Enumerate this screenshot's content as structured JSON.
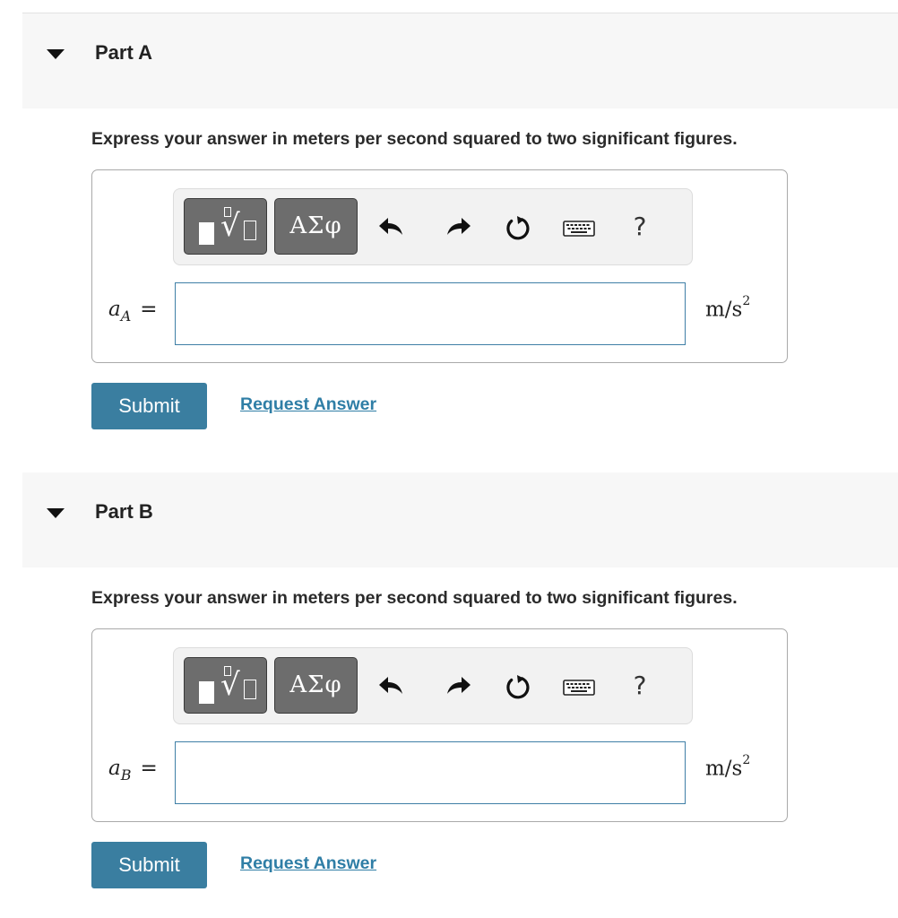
{
  "colors": {
    "header_bg": "#f7f7f7",
    "submit_bg": "#3a7ea0",
    "link": "#2f7ea6",
    "input_border": "#3f7fa6",
    "toolbar_button_bg": "#6d6d6d"
  },
  "toolbar": {
    "templates_icon": "square-root-template-icon",
    "symbols_label": "ΑΣφ",
    "undo_icon": "undo-arrow-icon",
    "redo_icon": "redo-arrow-icon",
    "reset_icon": "reset-circular-arrow-icon",
    "keyboard_icon": "keyboard-icon",
    "help_label": "?"
  },
  "parts": [
    {
      "title": "Part A",
      "instruction": "Express your answer in meters per second squared to two significant figures.",
      "variable": "a",
      "subscript": "A",
      "equals": "=",
      "input_value": "",
      "units_base": "m/s",
      "units_exponent": "2",
      "submit_label": "Submit",
      "request_label": "Request Answer"
    },
    {
      "title": "Part B",
      "instruction": "Express your answer in meters per second squared to two significant figures.",
      "variable": "a",
      "subscript": "B",
      "equals": "=",
      "input_value": "",
      "units_base": "m/s",
      "units_exponent": "2",
      "submit_label": "Submit",
      "request_label": "Request Answer"
    }
  ]
}
